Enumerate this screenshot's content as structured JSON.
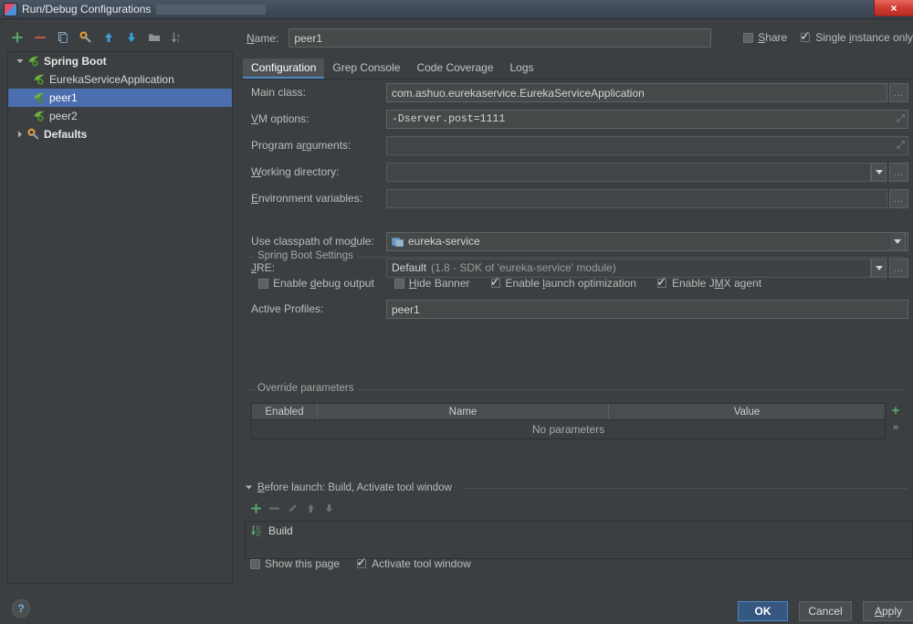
{
  "window": {
    "title": "Run/Debug Configurations",
    "close_label": "×"
  },
  "toolbar": {
    "buttons": [
      {
        "name": "add-configuration",
        "icon": "plus-icon",
        "label": "+"
      },
      {
        "name": "remove-configuration",
        "icon": "minus-icon",
        "label": "−"
      },
      {
        "name": "copy-configuration",
        "icon": "copy-icon",
        "label": "Copy"
      },
      {
        "name": "edit-defaults",
        "icon": "wrench-icon",
        "label": "Edit defaults"
      },
      {
        "name": "move-up",
        "icon": "arrow-up-icon",
        "label": "Move Up"
      },
      {
        "name": "move-down",
        "icon": "arrow-down-icon",
        "label": "Move Down"
      },
      {
        "name": "create-folder",
        "icon": "folder-icon",
        "label": "Create Folder"
      },
      {
        "name": "sort-configurations",
        "icon": "sort-az-icon",
        "label": "Sort Configurations"
      }
    ]
  },
  "tree": {
    "nodes": [
      {
        "label": "Spring Boot",
        "icon": "spring-boot-icon",
        "expanded": true,
        "level": 0,
        "bold": true,
        "selected": false
      },
      {
        "label": "EurekaServiceApplication",
        "icon": "spring-boot-icon",
        "level": 1,
        "bold": false,
        "selected": false
      },
      {
        "label": "peer1",
        "icon": "spring-boot-icon",
        "level": 1,
        "bold": false,
        "selected": true
      },
      {
        "label": "peer2",
        "icon": "spring-boot-icon",
        "level": 1,
        "bold": false,
        "selected": false
      },
      {
        "label": "Defaults",
        "icon": "wrench-icon",
        "expanded": false,
        "level": 0,
        "bold": true,
        "selected": false
      }
    ]
  },
  "name_row": {
    "label": "Name:",
    "label_mnemonic": "N",
    "value": "peer1"
  },
  "top_checkboxes": [
    {
      "label": "Share",
      "mnemonic": "S",
      "checked": false,
      "name": "share-checkbox"
    },
    {
      "label": "Single instance only",
      "mnemonic": "i",
      "checked": true,
      "name": "single-instance-only-checkbox"
    }
  ],
  "tabs": [
    {
      "label": "Configuration",
      "active": true
    },
    {
      "label": "Grep Console",
      "active": false
    },
    {
      "label": "Code Coverage",
      "active": false
    },
    {
      "label": "Logs",
      "active": false
    }
  ],
  "fields": {
    "main_class": {
      "label": "Main class:",
      "value": "com.ashuo.eurekaservice.EurekaServiceApplication",
      "browse": "..."
    },
    "vm_options": {
      "label": "VM options:",
      "mnemonic": "V",
      "value": "-Dserver.post=1111",
      "expand": "⤢"
    },
    "program_arguments": {
      "label": "Program arguments:",
      "mnemonic": "r",
      "value": "",
      "expand": "⤢"
    },
    "working_directory": {
      "label": "Working directory:",
      "mnemonic": "W",
      "value": "",
      "browse": "...",
      "dropdown": true
    },
    "environment_variables": {
      "label": "Environment variables:",
      "mnemonic": "E",
      "value": "",
      "browse": "..."
    },
    "use_classpath_of_module": {
      "label": "Use classpath of module:",
      "mnemonic": "d",
      "value": "eureka-service",
      "icon": "module-icon",
      "dropdown": true
    },
    "jre": {
      "label": "JRE:",
      "mnemonic": "J",
      "value": "Default",
      "value_suffix": "(1.8 - SDK of 'eureka-service' module)",
      "browse": "...",
      "dropdown": true
    }
  },
  "spring_boot_settings": {
    "title": "Spring Boot Settings",
    "checkboxes": [
      {
        "label": "Enable debug output",
        "mnemonic": "d",
        "checked": false,
        "name": "enable-debug-output-checkbox"
      },
      {
        "label": "Hide Banner",
        "mnemonic": "H",
        "checked": false,
        "name": "hide-banner-checkbox"
      },
      {
        "label": "Enable launch optimization",
        "mnemonic": "l",
        "checked": true,
        "name": "enable-launch-optimization-checkbox"
      },
      {
        "label": "Enable JMX agent",
        "mnemonic": "M",
        "checked": true,
        "name": "enable-jmx-agent-checkbox"
      }
    ],
    "active_profiles": {
      "label": "Active Profiles:",
      "value": "peer1"
    }
  },
  "override_parameters": {
    "title": "Override parameters",
    "columns": [
      "Enabled",
      "Name",
      "Value"
    ],
    "empty_text": "No parameters",
    "rows": [],
    "add_label": "+",
    "more_label": "»"
  },
  "before_launch": {
    "title": "Before launch: Build, Activate tool window",
    "mnemonic": "B",
    "toolbar": [
      {
        "name": "add-task-button",
        "icon": "plus-icon",
        "enabled": true
      },
      {
        "name": "remove-task-button",
        "icon": "minus-icon",
        "enabled": false
      },
      {
        "name": "edit-task-button",
        "icon": "pencil-icon",
        "enabled": false
      },
      {
        "name": "move-task-up-button",
        "icon": "arrow-up-icon",
        "enabled": false
      },
      {
        "name": "move-task-down-button",
        "icon": "arrow-down-icon",
        "enabled": false
      }
    ],
    "tasks": [
      {
        "label": "Build",
        "icon": "build-icon"
      }
    ],
    "checkboxes": [
      {
        "label": "Show this page",
        "checked": false,
        "name": "show-this-page-checkbox"
      },
      {
        "label": "Activate tool window",
        "checked": true,
        "name": "activate-tool-window-checkbox"
      }
    ]
  },
  "footer": {
    "help_label": "?",
    "ok_label": "OK",
    "cancel_label": "Cancel",
    "apply_label": "Apply",
    "apply_mnemonic": "A"
  },
  "colors": {
    "background": "#3c3f41",
    "selection": "#4b6eaf",
    "accent": "#4a88c7",
    "primary_button": "#365880",
    "green": "#5aa85a",
    "red": "#d96459"
  }
}
